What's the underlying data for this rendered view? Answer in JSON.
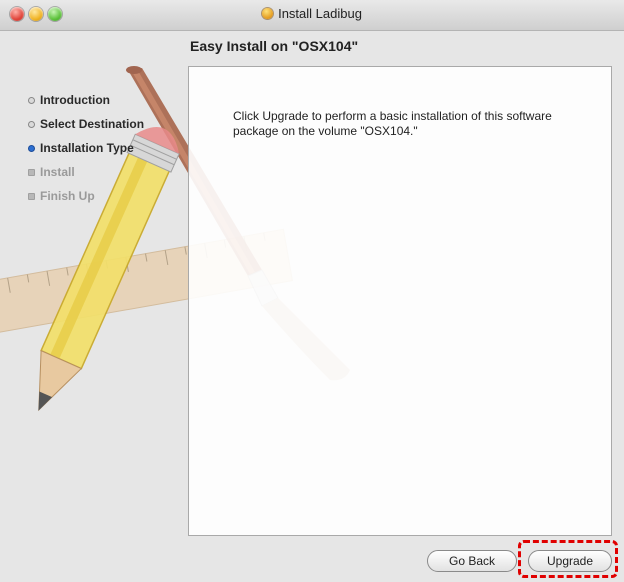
{
  "window": {
    "title": "Install Ladibug",
    "colors": {
      "highlight": "#e00000",
      "current_step": "#2d6fd1"
    }
  },
  "header": {
    "title": "Easy Install on \"OSX104\""
  },
  "sidebar": {
    "steps": [
      {
        "label": "Introduction",
        "state": "done"
      },
      {
        "label": "Select Destination",
        "state": "done"
      },
      {
        "label": "Installation Type",
        "state": "current"
      },
      {
        "label": "Install",
        "state": "disabled"
      },
      {
        "label": "Finish Up",
        "state": "disabled"
      }
    ]
  },
  "content": {
    "message": "Click Upgrade to perform a basic installation of this software package on the volume \"OSX104.\""
  },
  "buttons": {
    "go_back": "Go Back",
    "upgrade": "Upgrade"
  }
}
